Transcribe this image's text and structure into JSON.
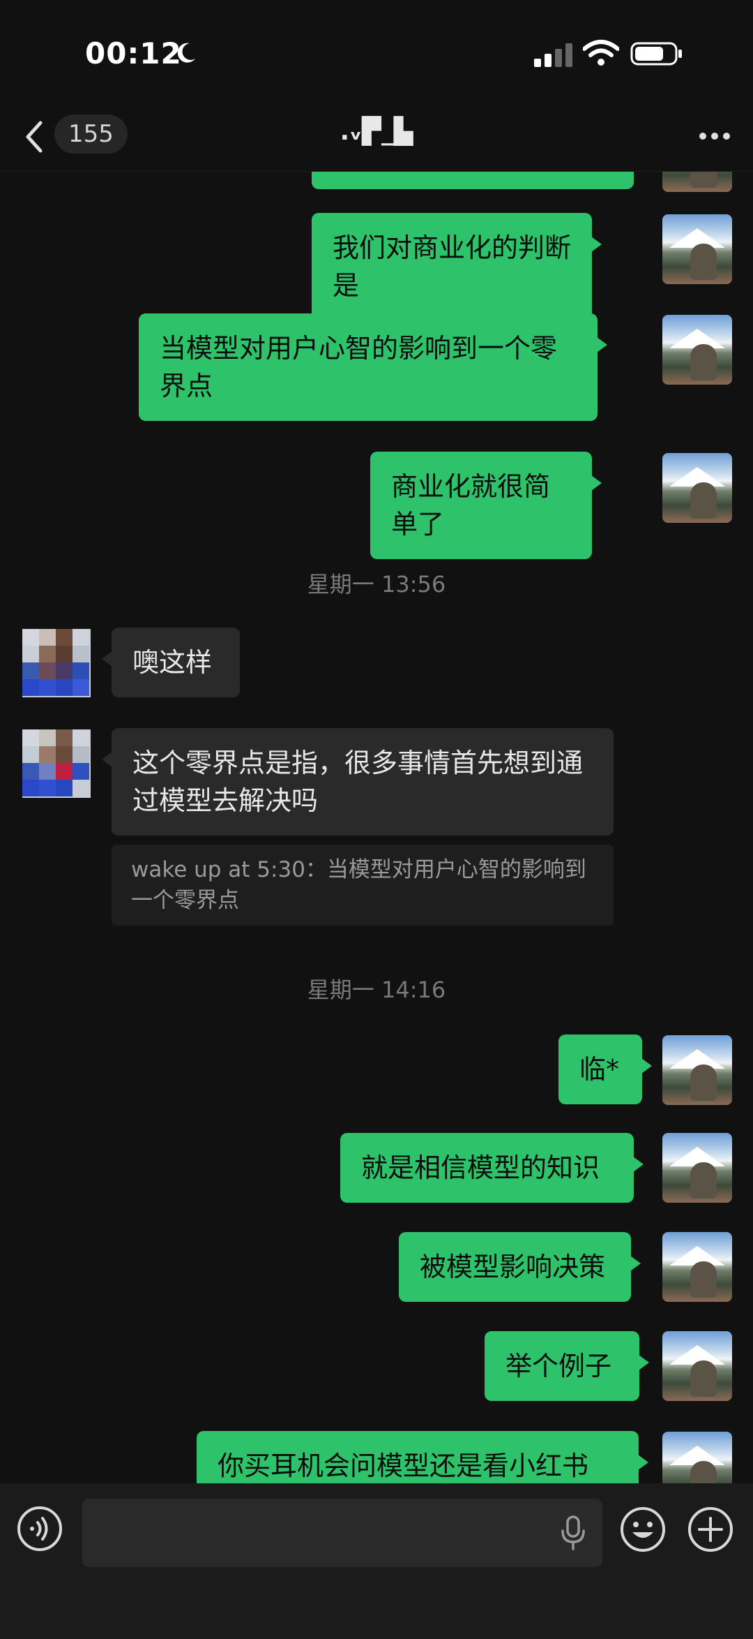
{
  "status_bar": {
    "time": "00:12"
  },
  "nav": {
    "unread_count": "155",
    "title": ".ᵥ▛_▙"
  },
  "messages": {
    "m0": "",
    "m1": "我们对商业化的判断是",
    "m2": "当模型对用户心智的影响到一个零界点",
    "m3": "商业化就很简单了",
    "ts1": "星期一 13:56",
    "m4": "噢这样",
    "m5": "这个零界点是指，很多事情首先想到通过模型去解决吗",
    "m5_quote": "wake up at 5:30：当模型对用户心智的影响到一个零界点",
    "ts2": "星期一 14:16",
    "m6": "临*",
    "m7": "就是相信模型的知识",
    "m8": "被模型影响决策",
    "m9": "举个例子",
    "m10": "你买耳机会问模型还是看小红书"
  },
  "input": {
    "placeholder": ""
  },
  "colors": {
    "outgoing_bubble": "#2ec26a",
    "incoming_bubble": "#2a2a2a",
    "background": "#111111"
  },
  "icons": [
    "moon-icon",
    "signal-icon",
    "wifi-icon",
    "battery-icon",
    "back-chevron-icon",
    "more-icon",
    "voice-icon",
    "mic-icon",
    "emoji-icon",
    "plus-icon"
  ]
}
